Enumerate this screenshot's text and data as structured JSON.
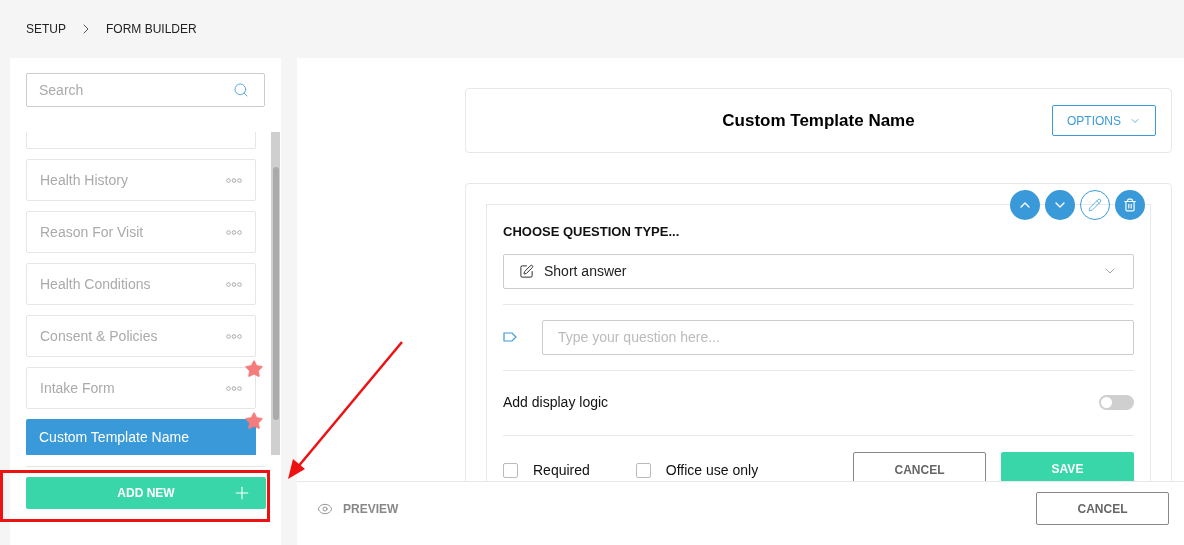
{
  "breadcrumb": [
    "SETUP",
    "FORM BUILDER"
  ],
  "sidebar": {
    "search": {
      "placeholder": "Search"
    },
    "items": [
      {
        "label": "Health History",
        "selected": false,
        "starred": false
      },
      {
        "label": "Reason For Visit",
        "selected": false,
        "starred": false
      },
      {
        "label": "Health Conditions",
        "selected": false,
        "starred": false
      },
      {
        "label": "Consent & Policies",
        "selected": false,
        "starred": false
      },
      {
        "label": "Intake Form",
        "selected": false,
        "starred": true
      },
      {
        "label": "Custom Template Name",
        "selected": true,
        "starred": true
      }
    ],
    "add_button": "ADD NEW"
  },
  "header": {
    "title": "Custom Template Name",
    "options_button": "OPTIONS"
  },
  "question": {
    "heading": "CHOOSE QUESTION TYPE...",
    "type": "Short answer",
    "question_placeholder": "Type your question here...",
    "display_logic": {
      "label": "Add display logic",
      "on": false
    },
    "checkboxes": [
      {
        "label": "Required",
        "checked": false
      },
      {
        "label": "Office use only",
        "checked": false
      }
    ],
    "cancel": "CANCEL",
    "save": "SAVE"
  },
  "footer": {
    "preview": "PREVIEW",
    "cancel": "CANCEL"
  }
}
